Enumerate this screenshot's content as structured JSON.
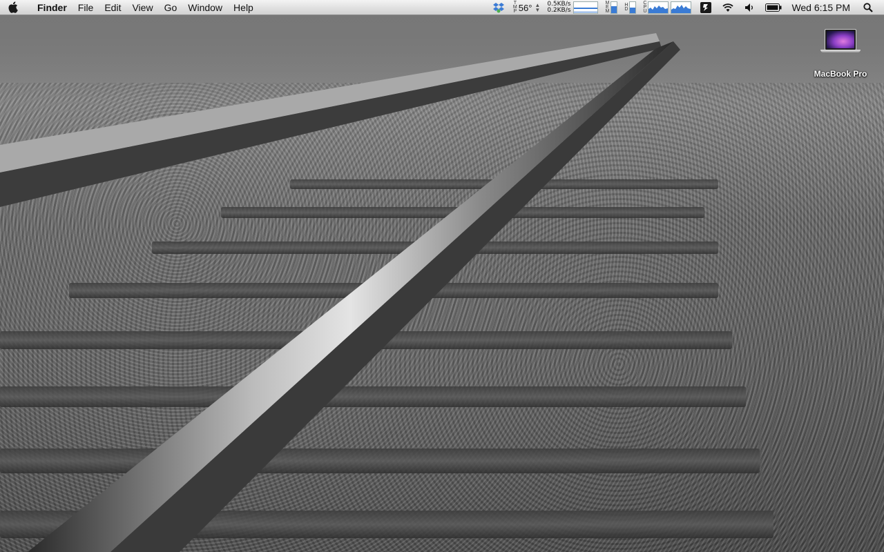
{
  "menubar": {
    "app_name": "Finder",
    "menus": [
      "File",
      "Edit",
      "View",
      "Go",
      "Window",
      "Help"
    ],
    "temperature": {
      "label_letters": [
        "T",
        "M",
        "P"
      ],
      "value": "56°"
    },
    "network": {
      "upload": "0.5KB/s",
      "download": "0.2KB/s"
    },
    "memory_label": [
      "M",
      "E",
      "M"
    ],
    "disk_label": [
      "H",
      "D"
    ],
    "cpu_label": [
      "C",
      "P",
      "U"
    ],
    "memory_fill_fraction": 0.6,
    "disk_fill_fraction": 0.5,
    "clock": "Wed 6:15 PM"
  },
  "desktop": {
    "icons": [
      {
        "label": "MacBook Pro"
      }
    ]
  },
  "colors": {
    "menubar_top": "#f4f4f4",
    "menubar_bottom": "#d2d2d2",
    "meter_blue": "#3a7bd5",
    "icon_label_text": "#ffffff"
  }
}
